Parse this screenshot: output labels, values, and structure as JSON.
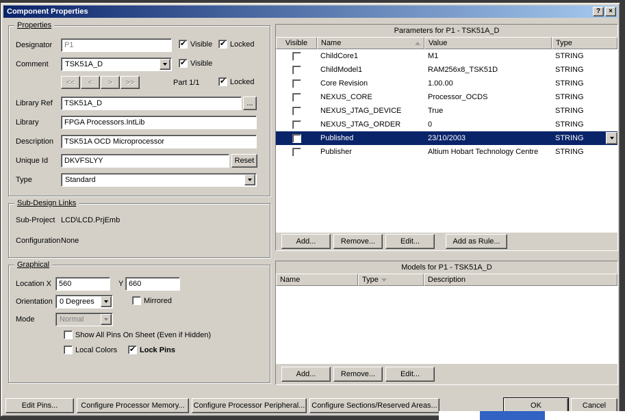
{
  "window": {
    "title": "Component Properties",
    "help_label": "?",
    "close_label": "×"
  },
  "colors": {
    "titlebar_start": "#0a246a",
    "titlebar_end": "#a6caf0",
    "selection": "#0a246a",
    "dialog_face": "#d4d0c8"
  },
  "properties": {
    "group_label": "Properties",
    "designator_label": "Designator",
    "designator_value": "P1",
    "visible_designator": {
      "label": "Visible",
      "checked": true
    },
    "locked_designator": {
      "label": "Locked",
      "checked": true
    },
    "comment_label": "Comment",
    "comment_value": "TSK51A_D",
    "visible_comment": {
      "label": "Visible",
      "checked": true
    },
    "nav_first": "<<",
    "nav_prev": "<",
    "nav_next": ">",
    "nav_last": ">>",
    "part_label": "Part 1/1",
    "locked_part": {
      "label": "Locked",
      "checked": true
    },
    "library_ref_label": "Library Ref",
    "library_ref_value": "TSK51A_D",
    "browse_label": "...",
    "library_label": "Library",
    "library_value": "FPGA Processors.IntLib",
    "description_label": "Description",
    "description_value": "TSK51A OCD Microprocessor",
    "unique_id_label": "Unique Id",
    "unique_id_value": "DKVFSLYY",
    "reset_label": "Reset",
    "type_label": "Type",
    "type_value": "Standard"
  },
  "sub_design": {
    "group_label": "Sub-Design Links",
    "sub_project_label": "Sub-Project",
    "sub_project_value": "LCD\\LCD.PrjEmb",
    "configuration_label": "Configuration",
    "configuration_value": "None"
  },
  "graphical": {
    "group_label": "Graphical",
    "location_x_label": "Location X",
    "location_x_value": "560",
    "location_y_label": "Y",
    "location_y_value": "660",
    "orientation_label": "Orientation",
    "orientation_value": "0 Degrees",
    "mirrored": {
      "label": "Mirrored",
      "checked": false
    },
    "mode_label": "Mode",
    "mode_value": "Normal",
    "show_all_pins": {
      "label": "Show All Pins On Sheet (Even if Hidden)",
      "checked": false
    },
    "local_colors": {
      "label": "Local Colors",
      "checked": false
    },
    "lock_pins": {
      "label": "Lock Pins",
      "checked": true
    }
  },
  "parameters": {
    "title": "Parameters for P1 - TSK51A_D",
    "columns": {
      "visible": "Visible",
      "name": "Name",
      "value": "Value",
      "type": "Type"
    },
    "rows": [
      {
        "visible": false,
        "name": "ChildCore1",
        "value": "M1",
        "type": "STRING",
        "selected": false
      },
      {
        "visible": false,
        "name": "ChildModel1",
        "value": "RAM256x8_TSK51D",
        "type": "STRING",
        "selected": false
      },
      {
        "visible": false,
        "name": "Core Revision",
        "value": "1.00.00",
        "type": "STRING",
        "selected": false
      },
      {
        "visible": false,
        "name": "NEXUS_CORE",
        "value": "Processor_OCDS",
        "type": "STRING",
        "selected": false
      },
      {
        "visible": false,
        "name": "NEXUS_JTAG_DEVICE",
        "value": "True",
        "type": "STRING",
        "selected": false
      },
      {
        "visible": false,
        "name": "NEXUS_JTAG_ORDER",
        "value": "0",
        "type": "STRING",
        "selected": false
      },
      {
        "visible": false,
        "name": "Published",
        "value": "23/10/2003",
        "type": "STRING",
        "selected": true
      },
      {
        "visible": false,
        "name": "Publisher",
        "value": "Altium Hobart Technology Centre",
        "type": "STRING",
        "selected": false
      }
    ],
    "add_label": "Add...",
    "remove_label": "Remove...",
    "edit_label": "Edit...",
    "add_rule_label": "Add as Rule..."
  },
  "models": {
    "title": "Models for P1 - TSK51A_D",
    "columns": {
      "name": "Name",
      "type": "Type",
      "description": "Description"
    },
    "rows": [],
    "add_label": "Add...",
    "remove_label": "Remove...",
    "edit_label": "Edit..."
  },
  "footer": {
    "edit_pins": "Edit Pins...",
    "config_memory": "Configure Processor Memory...",
    "config_peripheral": "Configure Processor Peripheral...",
    "config_sections": "Configure Sections/Reserved Areas...",
    "ok": "OK",
    "cancel": "Cancel"
  }
}
